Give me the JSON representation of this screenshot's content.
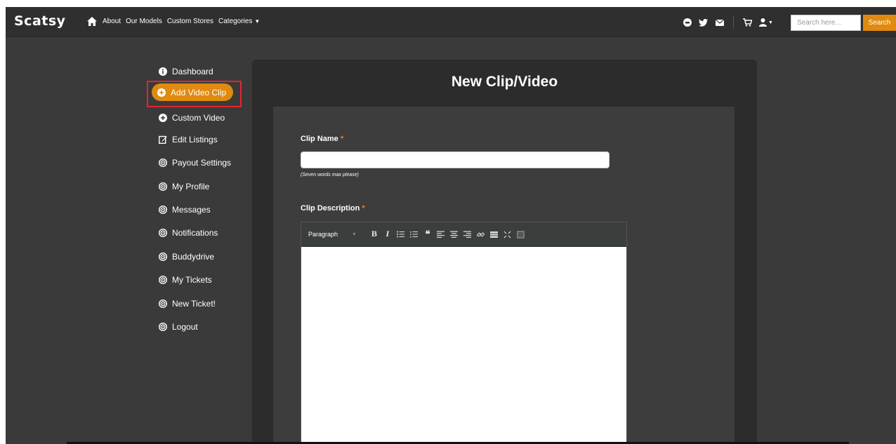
{
  "brand": "Scatsy",
  "nav": {
    "links": [
      "About",
      "Our Models",
      "Custom Stores",
      "Categories"
    ],
    "search_placeholder": "Search here...",
    "search_button": "Search"
  },
  "sidebar": {
    "items": [
      {
        "label": "Dashboard",
        "icon": "info-circle-icon"
      },
      {
        "label": "Add Video Clip",
        "icon": "plus-circle-icon",
        "active": true
      },
      {
        "label": "Custom Video",
        "icon": "plus-circle-icon"
      },
      {
        "label": "Edit Listings",
        "icon": "edit-icon"
      },
      {
        "label": "Payout Settings",
        "icon": "target-icon"
      },
      {
        "label": "My Profile",
        "icon": "target-icon"
      },
      {
        "label": "Messages",
        "icon": "target-icon"
      },
      {
        "label": "Notifications",
        "icon": "target-icon"
      },
      {
        "label": "Buddydrive",
        "icon": "target-icon"
      },
      {
        "label": "My Tickets",
        "icon": "target-icon"
      },
      {
        "label": "New Ticket!",
        "icon": "target-icon"
      },
      {
        "label": "Logout",
        "icon": "target-icon"
      }
    ]
  },
  "main": {
    "title": "New Clip/Video",
    "clip_name_label": "Clip Name",
    "required_mark": "*",
    "clip_name_hint": "(Seven words max please)",
    "clip_description_label": "Clip Description",
    "editor": {
      "format_select": "Paragraph"
    }
  },
  "colors": {
    "accent": "#e08a10",
    "highlight": "#e3262f",
    "background": "#3a3a3a",
    "navbar": "#2f2f2f",
    "panel": "#2c2c2c"
  }
}
